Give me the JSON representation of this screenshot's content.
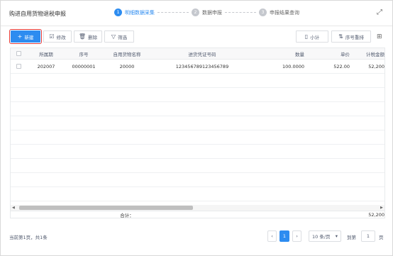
{
  "header": {
    "title": "购进自用货物退税申报",
    "expand_icon": "expand-icon",
    "steps": [
      {
        "num": "1",
        "label": "明细数据采集",
        "active": true
      },
      {
        "num": "2",
        "label": "数据申报",
        "active": false
      },
      {
        "num": "3",
        "label": "申报结果查询",
        "active": false
      }
    ]
  },
  "toolbar": {
    "new_label": "新建",
    "edit_label": "修改",
    "delete_label": "删除",
    "filter_label": "筛选",
    "subtotal_label": "小计",
    "sort_label": "序号重排",
    "icons": {
      "new": "plus-icon",
      "edit": "edit-icon",
      "delete": "trash-icon",
      "filter": "filter-icon",
      "subtotal": "bookmark-icon",
      "sort": "sort-icon",
      "columns": "grid-icon"
    }
  },
  "table": {
    "columns": [
      "所属期",
      "序号",
      "自用货物名称",
      "进货凭证号码",
      "数量",
      "单价",
      "计税金额"
    ],
    "rows": [
      {
        "period": "202007",
        "seq": "00000001",
        "name": "20000",
        "voucher": "123456789123456789",
        "qty": "100.0000",
        "price": "522.00",
        "amount": "52,200"
      }
    ],
    "footer_label": "合计：",
    "footer_total": "52,200"
  },
  "pagination": {
    "records_text": "当前第1页，共1条",
    "current_page": "1",
    "page_size": "10 条/页",
    "goto_label": "到第",
    "goto_value": "1",
    "page_unit": "页"
  },
  "colors": {
    "primary": "#2d8cf0",
    "highlight_border": "#e03a3a"
  }
}
